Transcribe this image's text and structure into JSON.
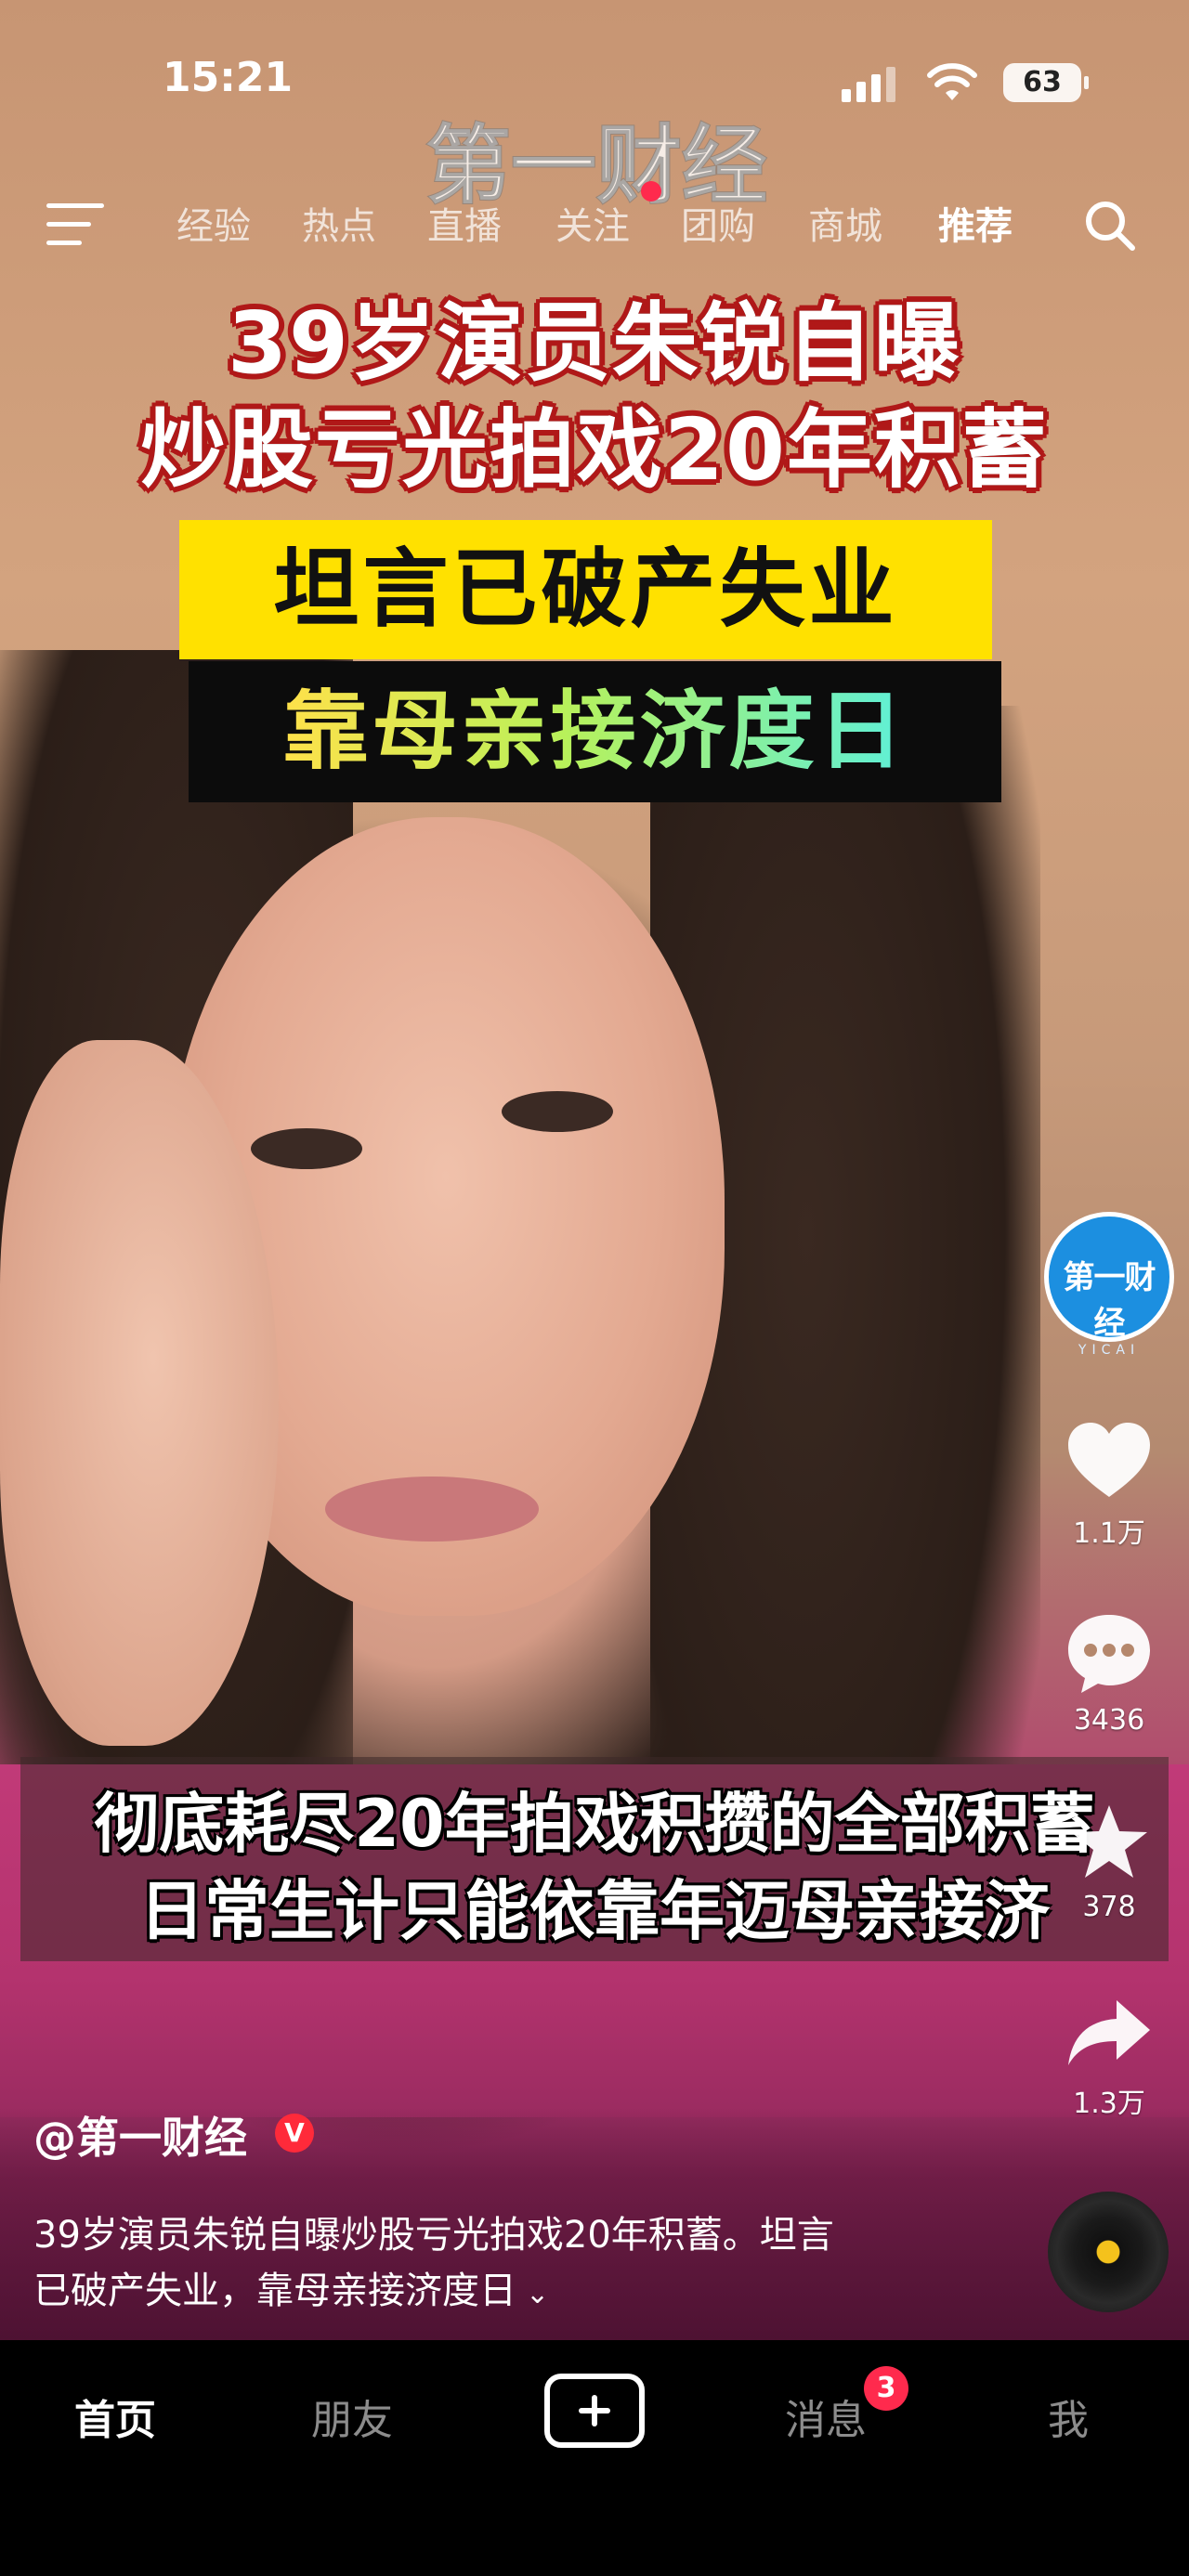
{
  "status_bar": {
    "time": "15:21",
    "battery": "63"
  },
  "top_nav": {
    "tabs": [
      {
        "label": "经验",
        "active": false
      },
      {
        "label": "热点",
        "active": false
      },
      {
        "label": "直播",
        "active": false
      },
      {
        "label": "关注",
        "active": false
      },
      {
        "label": "团购",
        "active": false
      },
      {
        "label": "商城",
        "active": false
      },
      {
        "label": "推荐",
        "active": true
      }
    ],
    "icons": [
      "menu-icon",
      "search-icon"
    ]
  },
  "video": {
    "watermark": "第一财经",
    "headline_lines": [
      "39岁演员朱锐自曝",
      "炒股亏光拍戏20年积蓄"
    ],
    "yellow_band": "坦言已破产失业",
    "black_band": "靠母亲接济度日",
    "subtitle_lines": [
      "彻底耗尽20年拍戏积攒的全部积蓄",
      "日常生计只能依靠年迈母亲接济"
    ]
  },
  "actions": {
    "avatar_text": "第一财经",
    "avatar_subtext": "YICAI",
    "like_count": "1.1万",
    "comment_count": "3436",
    "favorite_count": "378",
    "share_count": "1.3万"
  },
  "caption": {
    "author": "@第一财经",
    "verified_mark": "V",
    "line1": "39岁演员朱锐自曝炒股亏光拍戏20年积蓄。坦言",
    "line2": "已破产失业，靠母亲接济度日",
    "expand_icon": "chevron-down-icon"
  },
  "tab_bar": {
    "tabs": [
      "首页",
      "朋友",
      "消息",
      "我"
    ],
    "active": "首页",
    "message_badge": "3"
  },
  "colors": {
    "accent_red": "#ff2a4d",
    "band_yellow": "#ffe100",
    "headline_outline": "#b01818",
    "avatar_blue": "#1c8fe0"
  }
}
